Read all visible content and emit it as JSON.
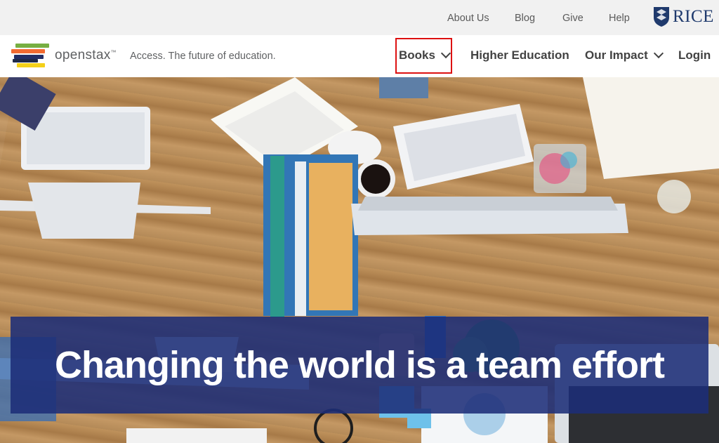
{
  "topbar": {
    "links": [
      "About Us",
      "Blog",
      "Give",
      "Help"
    ],
    "rice_label": "RICE"
  },
  "header": {
    "brand_name": "openstax",
    "brand_tm": "™",
    "tagline": "Access. The future of education.",
    "nav": [
      "Books",
      "Higher Education",
      "Our Impact",
      "Login"
    ]
  },
  "hero": {
    "headline": "Changing the world is a team effort"
  },
  "colors": {
    "logo_stripes": [
      "#77af42",
      "#f36b32",
      "#232e66",
      "#1f2a4a",
      "#f4d019"
    ],
    "banner": "#1c2d78",
    "highlight_border": "#dd1111"
  }
}
